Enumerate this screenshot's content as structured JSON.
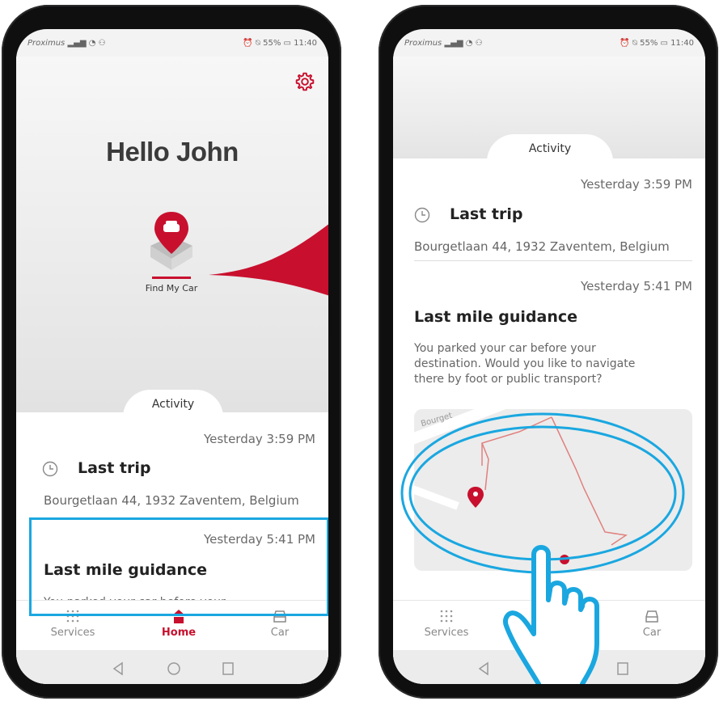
{
  "left_screen": {
    "status": {
      "carrier": "Proximus",
      "right": "55%",
      "time": "11:40"
    },
    "greeting": "Hello John",
    "find_my_car_label": "Find My Car",
    "activity_tab": "Activity",
    "trip": {
      "timestamp": "Yesterday 3:59 PM",
      "title": "Last trip",
      "address": "Bourgetlaan 44, 1932 Zaventem, Belgium"
    },
    "guidance": {
      "timestamp": "Yesterday 5:41 PM",
      "title": "Last mile guidance",
      "truncated_text": "You parked your car before your"
    },
    "nav": {
      "services": "Services",
      "home": "Home",
      "car": "Car"
    }
  },
  "right_screen": {
    "status": {
      "carrier": "Proximus",
      "right": "55%",
      "time": "11:40"
    },
    "activity_tab": "Activity",
    "trip": {
      "timestamp": "Yesterday 3:59 PM",
      "title": "Last trip",
      "address": "Bourgetlaan 44, 1932 Zaventem, Belgium"
    },
    "guidance": {
      "timestamp": "Yesterday 5:41 PM",
      "title": "Last mile guidance",
      "text": "You parked your car before your destination. Would you like to navigate there by foot or public transport?",
      "map_street_label": "Bourget"
    },
    "nav": {
      "services": "Services",
      "car": "Car"
    }
  },
  "colors": {
    "brand_red": "#c8102e",
    "highlight_blue": "#1aa7e0"
  },
  "icons": [
    "gear-icon",
    "clock-icon",
    "services-grid-icon",
    "home-icon",
    "car-icon",
    "map-pin-icon",
    "tap-hand-icon"
  ]
}
